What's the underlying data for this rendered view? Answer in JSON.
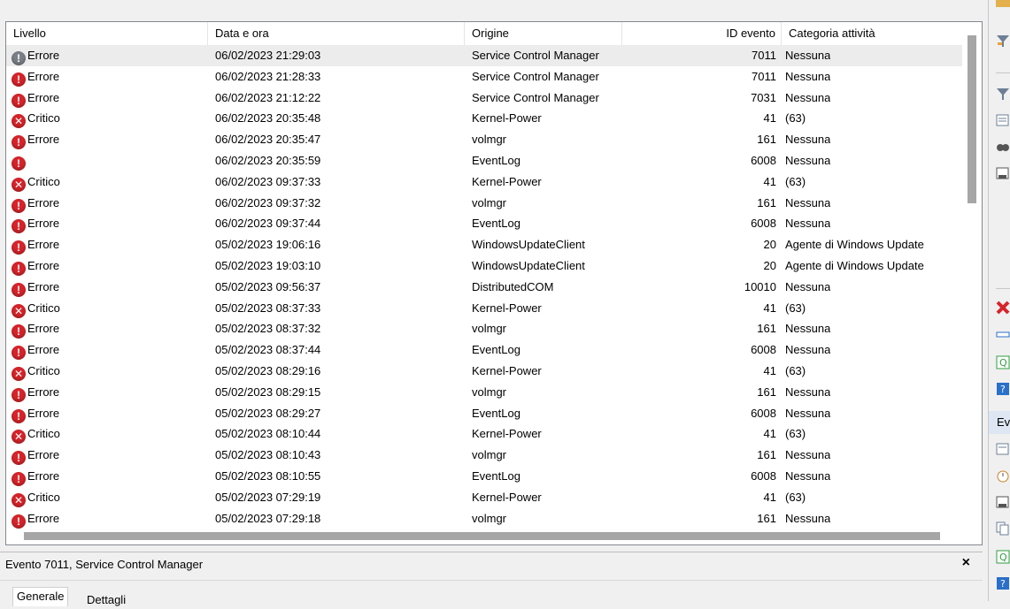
{
  "columns": {
    "level": "Livello",
    "datetime": "Data e ora",
    "source": "Origine",
    "event_id": "ID evento",
    "category": "Categoria attività"
  },
  "rows": [
    {
      "icon": "error-icon-gray",
      "level": "Errore",
      "datetime": "06/02/2023 21:29:03",
      "source": "Service Control Manager",
      "id": "7011",
      "category": "Nessuna"
    },
    {
      "icon": "error-icon",
      "level": "Errore",
      "datetime": "06/02/2023 21:28:33",
      "source": "Service Control Manager",
      "id": "7011",
      "category": "Nessuna"
    },
    {
      "icon": "error-icon",
      "level": "Errore",
      "datetime": "06/02/2023 21:12:22",
      "source": "Service Control Manager",
      "id": "7031",
      "category": "Nessuna"
    },
    {
      "icon": "critical-icon",
      "level": "Critico",
      "datetime": "06/02/2023 20:35:48",
      "source": "Kernel-Power",
      "id": "41",
      "category": "(63)"
    },
    {
      "icon": "error-icon",
      "level": "Errore",
      "datetime": "06/02/2023 20:35:47",
      "source": "volmgr",
      "id": "161",
      "category": "Nessuna"
    },
    {
      "icon": "error-icon",
      "level": "",
      "datetime": "06/02/2023 20:35:59",
      "source": "EventLog",
      "id": "6008",
      "category": "Nessuna"
    },
    {
      "icon": "critical-icon",
      "level": "Critico",
      "datetime": "06/02/2023 09:37:33",
      "source": "Kernel-Power",
      "id": "41",
      "category": "(63)"
    },
    {
      "icon": "error-icon",
      "level": "Errore",
      "datetime": "06/02/2023 09:37:32",
      "source": "volmgr",
      "id": "161",
      "category": "Nessuna"
    },
    {
      "icon": "error-icon",
      "level": "Errore",
      "datetime": "06/02/2023 09:37:44",
      "source": "EventLog",
      "id": "6008",
      "category": "Nessuna"
    },
    {
      "icon": "error-icon",
      "level": "Errore",
      "datetime": "05/02/2023 19:06:16",
      "source": "WindowsUpdateClient",
      "id": "20",
      "category": "Agente di Windows Update"
    },
    {
      "icon": "error-icon",
      "level": "Errore",
      "datetime": "05/02/2023 19:03:10",
      "source": "WindowsUpdateClient",
      "id": "20",
      "category": "Agente di Windows Update"
    },
    {
      "icon": "error-icon",
      "level": "Errore",
      "datetime": "05/02/2023 09:56:37",
      "source": "DistributedCOM",
      "id": "10010",
      "category": "Nessuna"
    },
    {
      "icon": "critical-icon",
      "level": "Critico",
      "datetime": "05/02/2023 08:37:33",
      "source": "Kernel-Power",
      "id": "41",
      "category": "(63)"
    },
    {
      "icon": "error-icon",
      "level": "Errore",
      "datetime": "05/02/2023 08:37:32",
      "source": "volmgr",
      "id": "161",
      "category": "Nessuna"
    },
    {
      "icon": "error-icon",
      "level": "Errore",
      "datetime": "05/02/2023 08:37:44",
      "source": "EventLog",
      "id": "6008",
      "category": "Nessuna"
    },
    {
      "icon": "critical-icon",
      "level": "Critico",
      "datetime": "05/02/2023 08:29:16",
      "source": "Kernel-Power",
      "id": "41",
      "category": "(63)"
    },
    {
      "icon": "error-icon",
      "level": "Errore",
      "datetime": "05/02/2023 08:29:15",
      "source": "volmgr",
      "id": "161",
      "category": "Nessuna"
    },
    {
      "icon": "error-icon",
      "level": "Errore",
      "datetime": "05/02/2023 08:29:27",
      "source": "EventLog",
      "id": "6008",
      "category": "Nessuna"
    },
    {
      "icon": "critical-icon",
      "level": "Critico",
      "datetime": "05/02/2023 08:10:44",
      "source": "Kernel-Power",
      "id": "41",
      "category": "(63)"
    },
    {
      "icon": "error-icon",
      "level": "Errore",
      "datetime": "05/02/2023 08:10:43",
      "source": "volmgr",
      "id": "161",
      "category": "Nessuna"
    },
    {
      "icon": "error-icon",
      "level": "Errore",
      "datetime": "05/02/2023 08:10:55",
      "source": "EventLog",
      "id": "6008",
      "category": "Nessuna"
    },
    {
      "icon": "critical-icon",
      "level": "Critico",
      "datetime": "05/02/2023 07:29:19",
      "source": "Kernel-Power",
      "id": "41",
      "category": "(63)"
    },
    {
      "icon": "error-icon",
      "level": "Errore",
      "datetime": "05/02/2023 07:29:18",
      "source": "volmgr",
      "id": "161",
      "category": "Nessuna"
    }
  ],
  "detail": {
    "title": "Evento 7011, Service Control Manager",
    "close": "×",
    "tab_general": "Generale",
    "tab_details": "Dettagli"
  },
  "right_panel": {
    "section_label": "Ev"
  },
  "colors": {
    "error": "#d6242a",
    "selected_row": "#ececec"
  }
}
